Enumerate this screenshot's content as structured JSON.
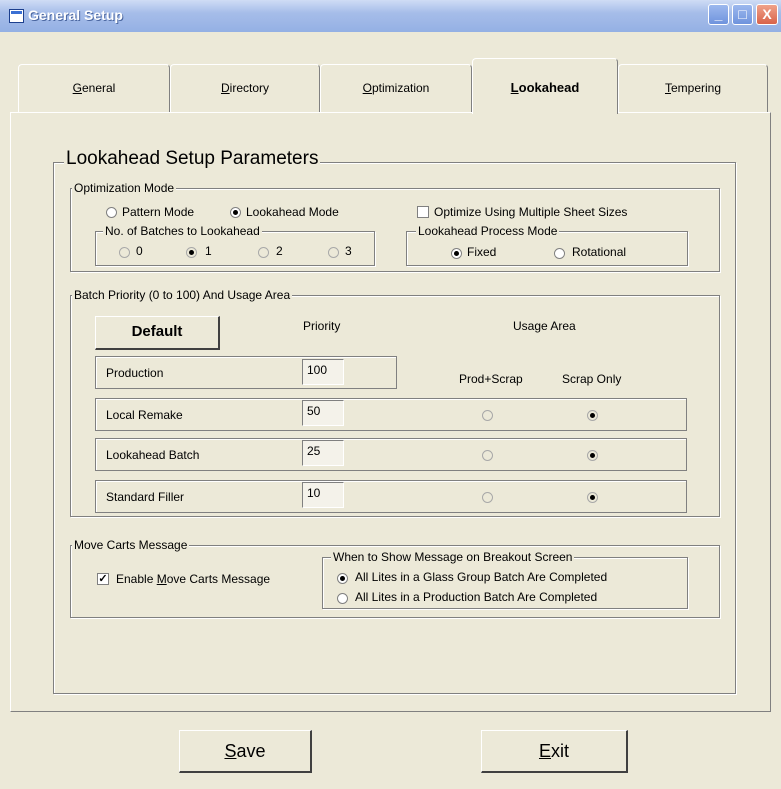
{
  "window": {
    "title": "General Setup",
    "minimize": "_",
    "maximize": "□",
    "close": "X"
  },
  "tabs": [
    {
      "label": "General",
      "underline": "G",
      "rest": "eneral"
    },
    {
      "label": "Directory",
      "underline": "D",
      "rest": "irectory"
    },
    {
      "label": "Optimization",
      "underline": "O",
      "rest": "ptimization"
    },
    {
      "label": "Lookahead",
      "underline": "L",
      "rest": "ookahead"
    },
    {
      "label": "Tempering",
      "underline": "T",
      "rest": "empering"
    }
  ],
  "active_tab": "Lookahead",
  "panel_title": "Lookahead Setup Parameters",
  "optimization_mode": {
    "legend": "Optimization Mode",
    "pattern_label": "Pattern Mode",
    "lookahead_label": "Lookahead Mode",
    "selected": "Lookahead Mode",
    "multi_sheet_label": "Optimize Using Multiple Sheet Sizes",
    "multi_sheet_checked": false,
    "batches": {
      "legend": "No. of Batches to Lookahead",
      "options": [
        "0",
        "1",
        "2",
        "3"
      ],
      "selected": "1"
    },
    "process_mode": {
      "legend": "Lookahead Process Mode",
      "options": [
        "Fixed",
        "Rotational"
      ],
      "selected": "Fixed"
    }
  },
  "batch_priority": {
    "legend": "Batch Priority (0 to 100) And Usage Area",
    "default_button": "Default",
    "priority_header": "Priority",
    "usage_header": "Usage Area",
    "col_prod_scrap": "Prod+Scrap",
    "col_scrap_only": "Scrap Only",
    "rows": [
      {
        "label": "Production",
        "priority": "100",
        "usage": null
      },
      {
        "label": "Local Remake",
        "priority": "50",
        "usage": "Scrap Only"
      },
      {
        "label": "Lookahead Batch",
        "priority": "25",
        "usage": "Scrap Only"
      },
      {
        "label": "Standard Filler",
        "priority": "10",
        "usage": "Scrap Only"
      }
    ]
  },
  "move_carts": {
    "legend": "Move Carts Message",
    "enable_label_pre": "Enable ",
    "enable_label_ul": "M",
    "enable_label_post": "ove Carts Message",
    "enabled": true,
    "when": {
      "legend": "When to Show Message on Breakout Screen",
      "options": [
        "All Lites in a Glass Group Batch Are Completed",
        "All Lites in a Production Batch Are Completed"
      ],
      "selected": "All Lites in a Glass Group Batch Are Completed"
    }
  },
  "buttons": {
    "save": {
      "underline": "S",
      "rest": "ave"
    },
    "exit": {
      "underline": "E",
      "rest": "xit"
    }
  },
  "colors": {
    "face": "#ece9d8",
    "title_gradient_top": "#cfdcf5",
    "title_gradient_bottom": "#94b0e4"
  }
}
